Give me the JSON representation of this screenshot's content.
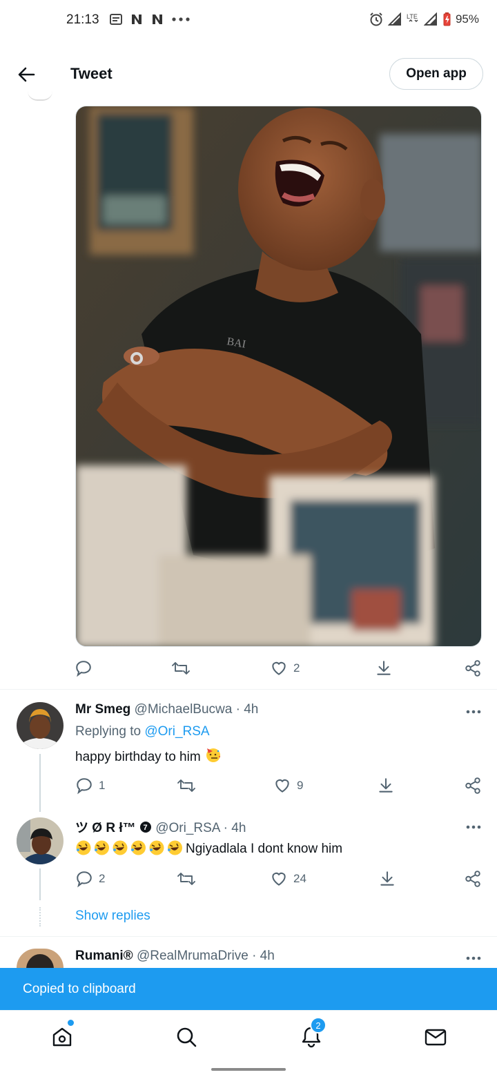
{
  "status_bar": {
    "time": "21:13",
    "left_icons": [
      "notepad-icon",
      "netflix-n-icon",
      "netflix-n-icon",
      "more-dots-icon"
    ],
    "battery_percent": "95%",
    "network": "LTE"
  },
  "header": {
    "title": "Tweet",
    "open_app_label": "Open app"
  },
  "tweet_actions": {
    "like_count": "2"
  },
  "replies": [
    {
      "name": "Mr Smeg",
      "handle": "@MichaelBucwa",
      "time": "· 4h",
      "replying_prefix": "Replying to ",
      "replying_to": "@Ori_RSA",
      "text": "happy birthday to him",
      "reply_count": "1",
      "retweet_count": "",
      "like_count": "9"
    },
    {
      "name": "ツ Ø R ł™",
      "handle": "@Ori_RSA",
      "time": "· 4h",
      "text": "Ngiyadlala I dont know him",
      "reply_count": "2",
      "retweet_count": "",
      "like_count": "24",
      "show_replies": "Show replies"
    },
    {
      "name": "Rumani®",
      "handle": "@RealMrumaDrive",
      "time": "· 4h"
    }
  ],
  "toast": "Copied to clipboard",
  "bottom_nav": {
    "items": [
      "home-icon",
      "search-icon",
      "notifications-icon",
      "messages-icon"
    ],
    "notifications_badge": "2"
  },
  "colors": {
    "accent": "#1d9bf0",
    "text_primary": "#0f1419",
    "text_secondary": "#536471"
  }
}
